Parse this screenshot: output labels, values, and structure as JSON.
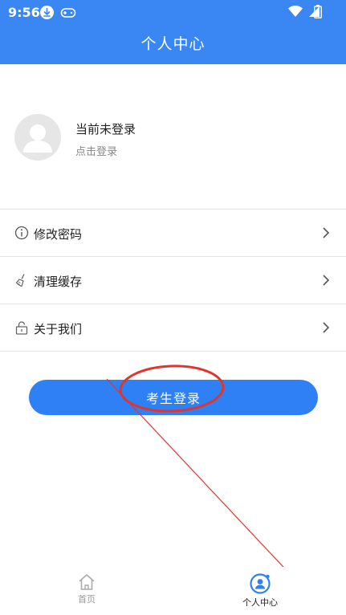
{
  "status_bar": {
    "time": "9:56"
  },
  "header": {
    "title": "个人中心"
  },
  "profile": {
    "name": "当前未登录",
    "subtitle": "点击登录"
  },
  "menu": {
    "items": [
      {
        "label": "修改密码",
        "icon": "info-circle-icon"
      },
      {
        "label": "清理缓存",
        "icon": "broom-icon"
      },
      {
        "label": "关于我们",
        "icon": "lock-icon"
      }
    ]
  },
  "login_button": {
    "label": "考生登录"
  },
  "tabbar": {
    "tabs": [
      {
        "label": "首页",
        "icon": "home-icon",
        "active": false
      },
      {
        "label": "个人中心",
        "icon": "user-icon",
        "active": true
      }
    ]
  },
  "colors": {
    "primary": "#3a86f2",
    "button": "#2f80f5",
    "annotation": "#e0352b"
  }
}
